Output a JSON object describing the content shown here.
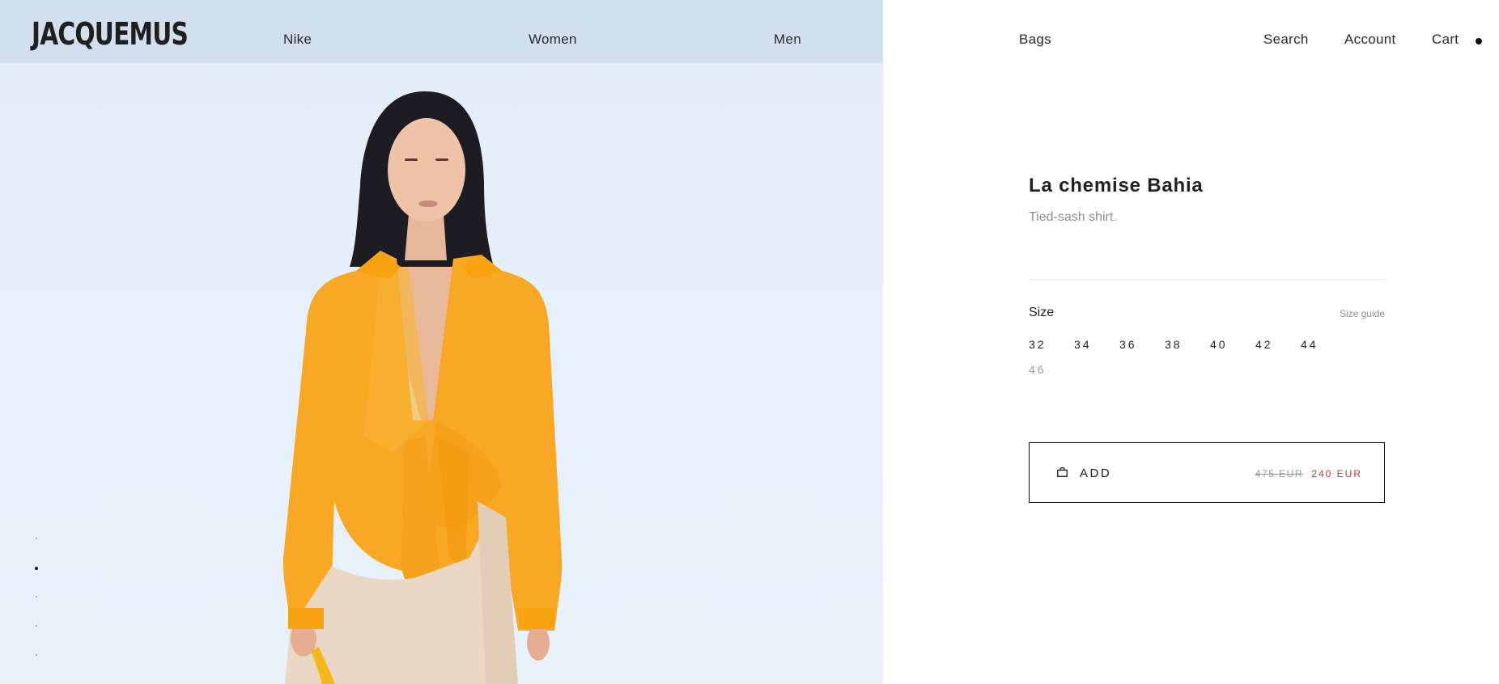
{
  "brand": {
    "logo": "JACQUEMUS"
  },
  "nav": {
    "items": [
      {
        "label": "Nike"
      },
      {
        "label": "Women"
      },
      {
        "label": "Men"
      },
      {
        "label": "Bags"
      }
    ],
    "utility": [
      {
        "label": "Search"
      },
      {
        "label": "Account"
      },
      {
        "label": "Cart"
      }
    ]
  },
  "gallery": {
    "image_count": 5,
    "active_index": 1
  },
  "product": {
    "name": "La chemise Bahia",
    "description": "Tied-sash shirt.",
    "size_label": "Size",
    "size_guide": "Size guide",
    "sizes": [
      {
        "label": "32",
        "available": true
      },
      {
        "label": "34",
        "available": true
      },
      {
        "label": "36",
        "available": true
      },
      {
        "label": "38",
        "available": true
      },
      {
        "label": "40",
        "available": true
      },
      {
        "label": "42",
        "available": true
      },
      {
        "label": "44",
        "available": true
      },
      {
        "label": "46",
        "available": false
      }
    ],
    "add_button": {
      "label": "ADD",
      "old_price": "475 EUR",
      "new_price": "240 EUR"
    }
  },
  "colors": {
    "header_band": "#d2dfee",
    "image_background": "#e6f0fa",
    "shirt": "#f9a825",
    "trousers": "#ead8c4",
    "sale_price": "#c0392b",
    "text": "#1c1c1c"
  }
}
